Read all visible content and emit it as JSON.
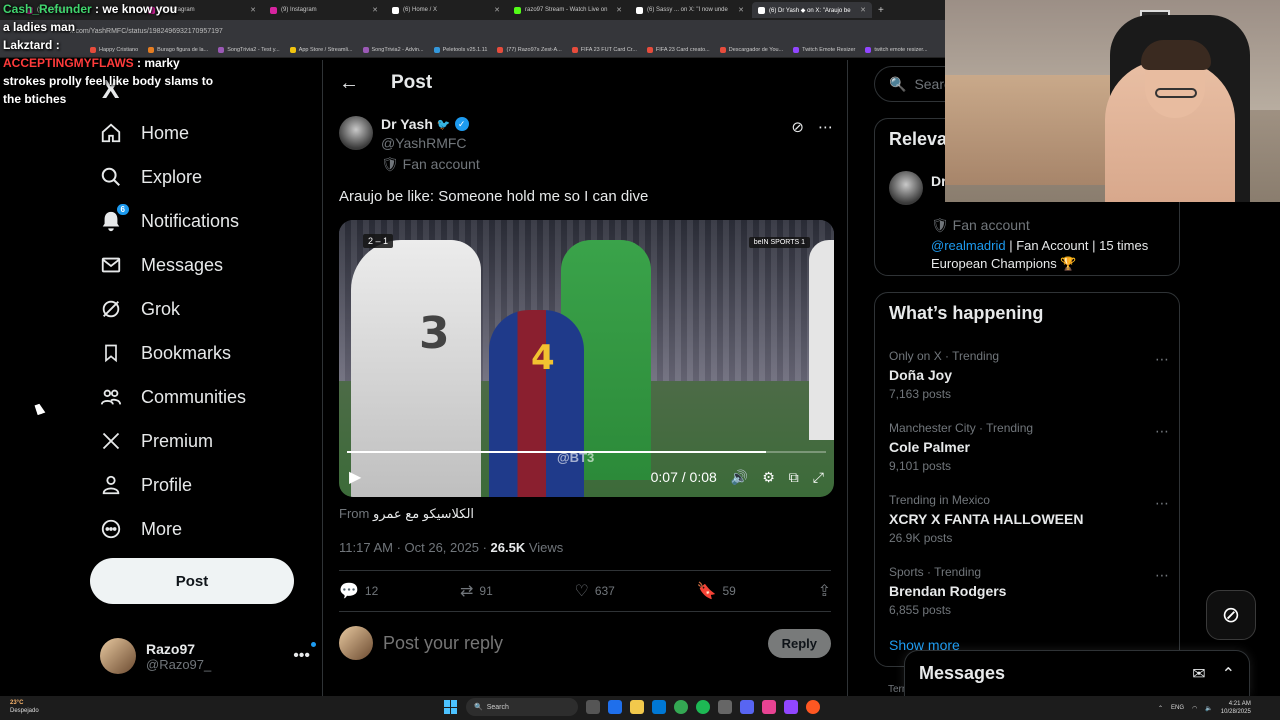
{
  "browser": {
    "tabs": [
      {
        "label": "(9) Instagram",
        "color": "#d6249f",
        "active": false
      },
      {
        "label": "(9) Instagram",
        "color": "#d6249f",
        "active": false
      },
      {
        "label": "(9) Instagram",
        "color": "#d6249f",
        "active": false
      },
      {
        "label": "(6) Home / X",
        "color": "#ffffff",
        "active": false
      },
      {
        "label": "razo97 Stream - Watch Live on",
        "color": "#53fc18",
        "active": false
      },
      {
        "label": "(6) Sassy ... on X: \"I now unde",
        "color": "#ffffff",
        "active": false
      },
      {
        "label": "(6) Dr Yash ◆ on X: \"Araujo be",
        "color": "#ffffff",
        "active": true
      }
    ],
    "new_tab": "+",
    "url": "x.com/YashRMFC/status/1982496932170957197",
    "bookmarks": [
      {
        "label": "Happy Cristiano",
        "color": "#e74c3c"
      },
      {
        "label": "Burago figura de la...",
        "color": "#e67e22"
      },
      {
        "label": "SongTrivia2 - Test y...",
        "color": "#9b59b6"
      },
      {
        "label": "App Store / Streamli...",
        "color": "#f1c40f"
      },
      {
        "label": "SongTrivia2 - Advin...",
        "color": "#9b59b6"
      },
      {
        "label": "Peletools v25.1.11",
        "color": "#3498db"
      },
      {
        "label": "(77) Razo97s Zest-A...",
        "color": "#e74c3c"
      },
      {
        "label": "FIFA 23 FUT Card Cr...",
        "color": "#e74c3c"
      },
      {
        "label": "FIFA 23 Card creato...",
        "color": "#e74c3c"
      },
      {
        "label": "Descargador de You...",
        "color": "#e74c3c"
      },
      {
        "label": "Twitch Emote Resizer",
        "color": "#9146ff"
      },
      {
        "label": "twitch emote resizer...",
        "color": "#9146ff"
      }
    ]
  },
  "chat": {
    "msg1_user": "Cash_Refunder",
    "msg1_text": ": we know you",
    "msg1_cont": "a ladies man",
    "msg2_user": "Lakztard",
    "msg2_text": ":",
    "msg3_user": "ACCEPTINGMYFLAWS",
    "msg3_text": ": marky strokes prolly feel like body slams to the btiches"
  },
  "sidebar": {
    "logo": "X",
    "nav": [
      {
        "label": "Home",
        "icon": "home-icon"
      },
      {
        "label": "Explore",
        "icon": "search-icon"
      },
      {
        "label": "Notifications",
        "icon": "bell-icon",
        "badge": "6"
      },
      {
        "label": "Messages",
        "icon": "envelope-icon"
      },
      {
        "label": "Grok",
        "icon": "grok-icon"
      },
      {
        "label": "Bookmarks",
        "icon": "bookmark-icon"
      },
      {
        "label": "Communities",
        "icon": "communities-icon"
      },
      {
        "label": "Premium",
        "icon": "x-logo-icon"
      },
      {
        "label": "Profile",
        "icon": "person-icon"
      },
      {
        "label": "More",
        "icon": "more-circle-icon"
      }
    ],
    "post_button": "Post",
    "account": {
      "name": "Razo97",
      "handle": "@Razo97_",
      "more": "•••"
    }
  },
  "main": {
    "back": "←",
    "title": "Post",
    "author": {
      "name": "Dr Yash",
      "handle": "@YashRMFC",
      "label": "Fan account",
      "bird": "🐦",
      "check": "✓"
    },
    "text": "Araujo be like: Someone hold me so I can dive",
    "video": {
      "time": "0:07 / 0:08",
      "progress": 0.875,
      "score_home": "2",
      "score_away": "1",
      "watermark": "@BT3",
      "broadcaster": "beIN SPORTS 1",
      "jersey_left": "3",
      "jersey_center": "4"
    },
    "from_prefix": "From",
    "from_source": "الكلاسيكو مع عمرو",
    "timestamp": "11:17 AM · Oct 26, 2025 · ",
    "views_count": "26.5K",
    "views_label": " Views",
    "stats": {
      "replies": "12",
      "reposts": "91",
      "likes": "637",
      "bookmarks": "59"
    },
    "reply_placeholder": "Post your reply",
    "reply_button": "Reply"
  },
  "right": {
    "search_placeholder": "Search",
    "relevant_title": "Relevant people",
    "relevant_person": {
      "name": "Dr Yash",
      "label": "Fan account",
      "mention": "@realmadrid",
      "bio": " | Fan Account | 15 times European Champions 🏆"
    },
    "happening_title": "What’s happening",
    "trends": [
      {
        "context": "Only on X · Trending",
        "name": "Doña Joy",
        "count": "7,163 posts"
      },
      {
        "context": "Manchester City · Trending",
        "name": "Cole Palmer",
        "count": "9,101 posts"
      },
      {
        "context": "Trending in Mexico",
        "name": "XCRY X FANTA HALLOWEEN",
        "count": "26.9K posts"
      },
      {
        "context": "Sports · Trending",
        "name": "Brendan Rodgers",
        "count": "6,855 posts"
      }
    ],
    "show_more": "Show more",
    "messages_title": "Messages",
    "terms": "Terms"
  },
  "taskbar": {
    "temp": "23°C",
    "weather": "Despejado",
    "search": "Search",
    "lang": "ENG",
    "time": "4:21 AM",
    "date": "10/28/2025"
  },
  "colors": {
    "accent": "#1d9bf0",
    "background": "#000000",
    "text": "#e7e9ea",
    "muted": "#71767b"
  }
}
